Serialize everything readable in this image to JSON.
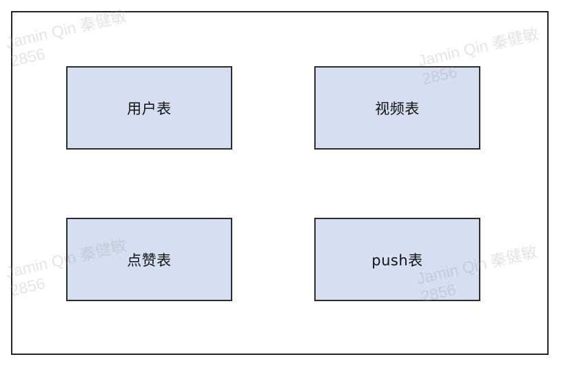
{
  "diagram": {
    "nodes": [
      {
        "id": "user",
        "label": "用户表"
      },
      {
        "id": "video",
        "label": "视频表"
      },
      {
        "id": "like",
        "label": "点赞表"
      },
      {
        "id": "push",
        "label": "push表"
      }
    ]
  },
  "watermark": {
    "line1": "Jamin Qin 秦健敏",
    "line2": "2856"
  },
  "colors": {
    "node_fill": "#d5dff1",
    "node_border": "#2b2b2b",
    "frame_border": "#222222"
  }
}
